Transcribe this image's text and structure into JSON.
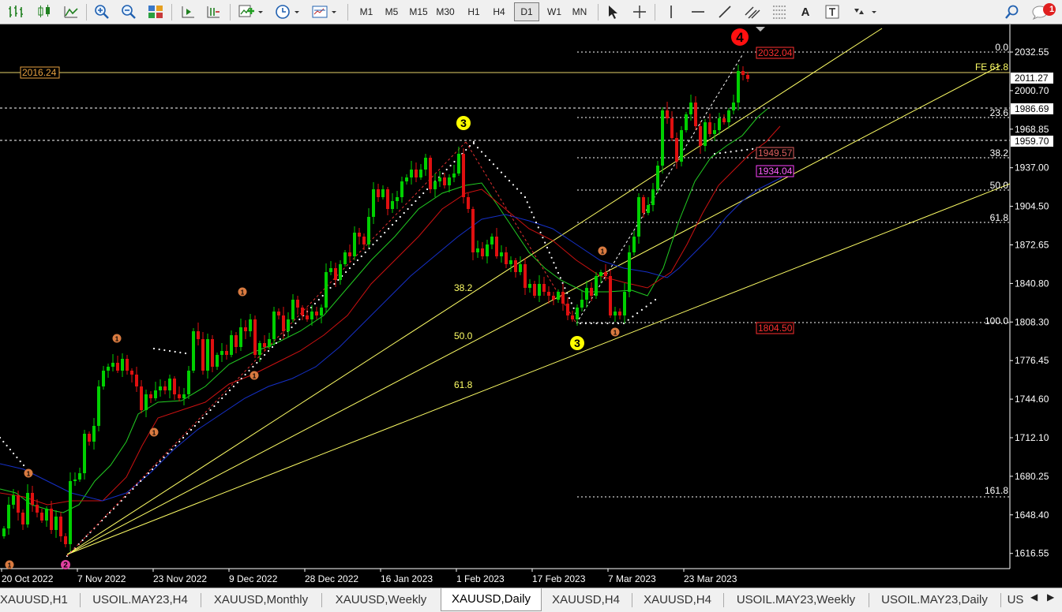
{
  "toolbar": {
    "timeframes": [
      {
        "label": "M1"
      },
      {
        "label": "M5"
      },
      {
        "label": "M15"
      },
      {
        "label": "M30"
      },
      {
        "label": "H1"
      },
      {
        "label": "H4"
      },
      {
        "label": "D1",
        "active": true
      },
      {
        "label": "W1"
      },
      {
        "label": "MN"
      }
    ],
    "text_tool": "A",
    "notification_count": "1"
  },
  "chart": {
    "price_labels": [
      "2032.55",
      "2000.70",
      "1968.85",
      "1937.00",
      "1904.50",
      "1872.65",
      "1840.80",
      "1808.30",
      "1776.45",
      "1744.60",
      "1712.10",
      "1680.25",
      "1648.40",
      "1616.55"
    ],
    "price_tags": [
      "2011.27",
      "1986.69",
      "1959.70"
    ],
    "left_level_tag": "2016.24",
    "date_labels": [
      "20 Oct 2022",
      "7 Nov 2022",
      "23 Nov 2022",
      "9 Dec 2022",
      "28 Dec 2022",
      "16 Jan 2023",
      "1 Feb 2023",
      "17 Feb 2023",
      "7 Mar 2023",
      "23 Mar 2023"
    ],
    "fib_retracement_labels": [
      "0.0",
      "23.6",
      "38.2",
      "50.0",
      "61.8",
      "100.0",
      "161.8"
    ],
    "fib_expansion_label": "FE 61.8",
    "fib_mid_labels": [
      "38.2",
      "50.0",
      "61.8"
    ],
    "small_tags": [
      "2032.04",
      "1949.57",
      "1934.04",
      "1804.50"
    ],
    "wave_labels": {
      "big4": "4",
      "big3_top": "3",
      "big3_bottom": "3",
      "big2": "2",
      "small": "1"
    }
  },
  "tabs": [
    {
      "label": "XAUUSD,H1"
    },
    {
      "label": "USOIL.MAY23,H4"
    },
    {
      "label": "XAUUSD,Monthly"
    },
    {
      "label": "XAUUSD,Weekly"
    },
    {
      "label": "XAUUSD,Daily",
      "active": true
    },
    {
      "label": "XAUUSD,H4"
    },
    {
      "label": "XAUUSD,H4"
    },
    {
      "label": "USOIL.MAY23,Weekly"
    },
    {
      "label": "USOIL.MAY23,Daily"
    },
    {
      "label": "US"
    }
  ],
  "colors": {
    "bull": "#00d000",
    "bear": "#e01010",
    "fib": "#ffff66",
    "ma_green": "#22cc22",
    "ma_red": "#cc1111",
    "ma_blue": "#1530c8"
  }
}
